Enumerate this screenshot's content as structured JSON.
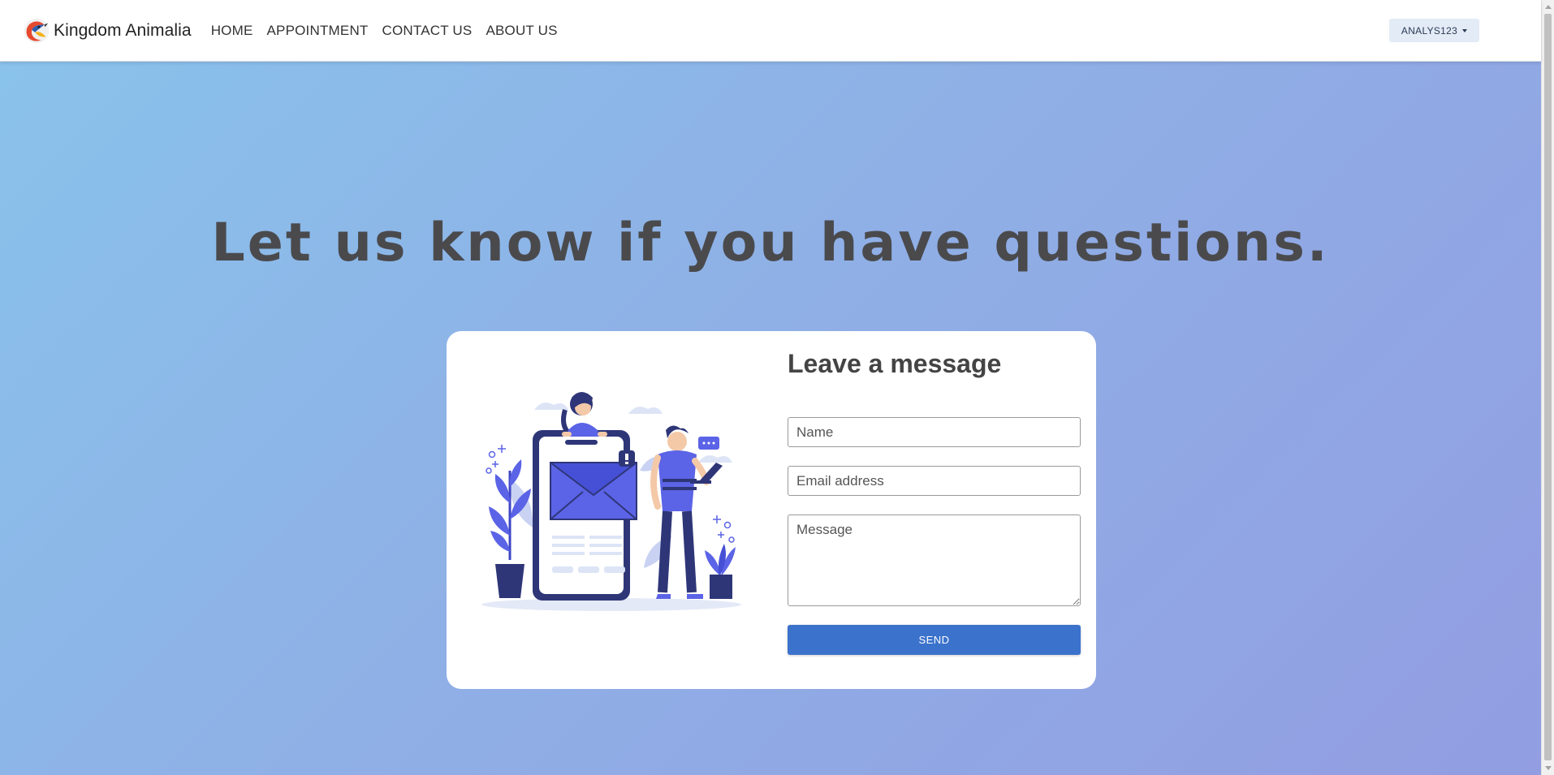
{
  "navbar": {
    "brand_name": "Kingdom Animalia",
    "links": [
      "HOME",
      "APPOINTMENT",
      "CONTACT US",
      "ABOUT US"
    ],
    "user_menu_label": "ANALYS123"
  },
  "hero": {
    "title": "Let us know if you have questions."
  },
  "contact_form": {
    "title": "Leave a message",
    "name_placeholder": "Name",
    "email_placeholder": "Email address",
    "message_placeholder": "Message",
    "send_label": "SEND"
  },
  "colors": {
    "primary_button": "#3b72cc",
    "hero_gradient_start": "#89c2eb",
    "hero_gradient_end": "#929de2",
    "illustration_accent": "#5b63e6"
  }
}
